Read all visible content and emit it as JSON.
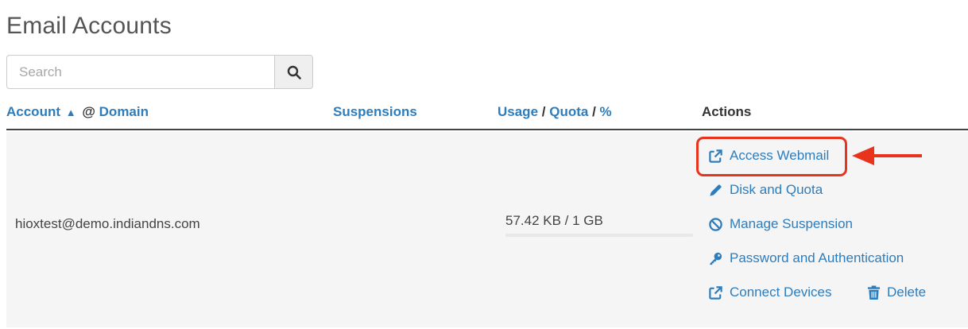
{
  "page": {
    "title": "Email Accounts"
  },
  "search": {
    "placeholder": "Search",
    "icon": "search-icon"
  },
  "table": {
    "headers": {
      "account": "Account",
      "sort_indicator": "▲",
      "at": "@",
      "domain": "Domain",
      "suspensions": "Suspensions",
      "usage": "Usage",
      "quota": "Quota",
      "percent": "%",
      "slash": "/",
      "actions": "Actions"
    },
    "rows": [
      {
        "account": "hioxtest@demo.indiandns.com",
        "usage": "57.42 KB / 1 GB",
        "usage_fraction": 0.0001,
        "actions": {
          "access_webmail": "Access Webmail",
          "disk_and_quota": "Disk and Quota",
          "manage_suspension": "Manage Suspension",
          "password_and_authentication": "Password and Authentication",
          "connect_devices": "Connect Devices",
          "delete": "Delete"
        }
      }
    ]
  },
  "colors": {
    "link": "#2d7dbd",
    "annotation": "#e8341c",
    "row_background": "#f5f5f5"
  }
}
